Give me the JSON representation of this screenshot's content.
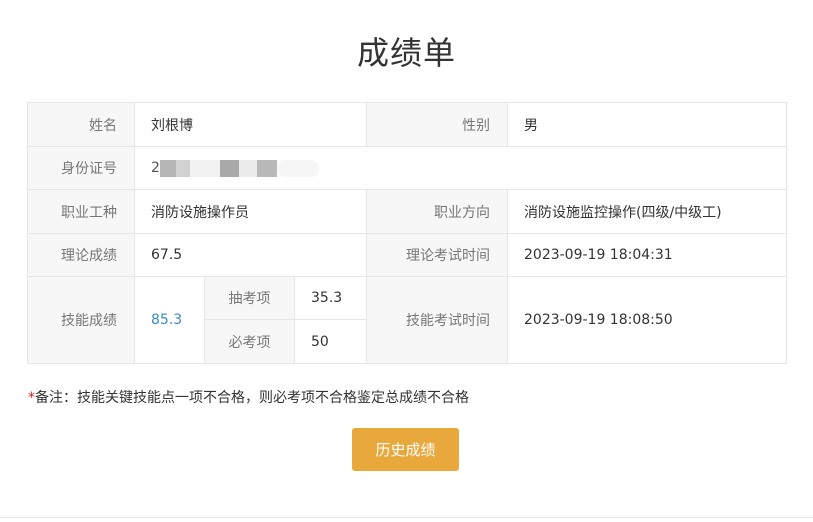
{
  "title": "成绩单",
  "labels": {
    "name": "姓名",
    "gender": "性别",
    "id_number": "身份证号",
    "occupation": "职业工种",
    "direction": "职业方向",
    "theory_score": "理论成绩",
    "theory_time": "理论考试时间",
    "skill_score": "技能成绩",
    "random_items": "抽考项",
    "required_items": "必考项",
    "skill_time": "技能考试时间"
  },
  "values": {
    "name": "刘根博",
    "gender": "男",
    "id_number_visible_prefix": "2",
    "occupation": "消防设施操作员",
    "direction": "消防设施监控操作(四级/中级工)",
    "theory_score": "67.5",
    "theory_time": "2023-09-19 18:04:31",
    "skill_score": "85.3",
    "random_items": "35.3",
    "required_items": "50",
    "skill_time": "2023-09-19 18:08:50"
  },
  "note": {
    "star": "*",
    "text": "备注：技能关键技能点一项不合格，则必考项不合格鉴定总成绩不合格"
  },
  "history_button": "历史成绩",
  "colors": {
    "accent_button": "#e8a83c",
    "link_score": "#3c8bc9",
    "label_bg": "#f7f7f7",
    "note_star": "#e02020"
  }
}
